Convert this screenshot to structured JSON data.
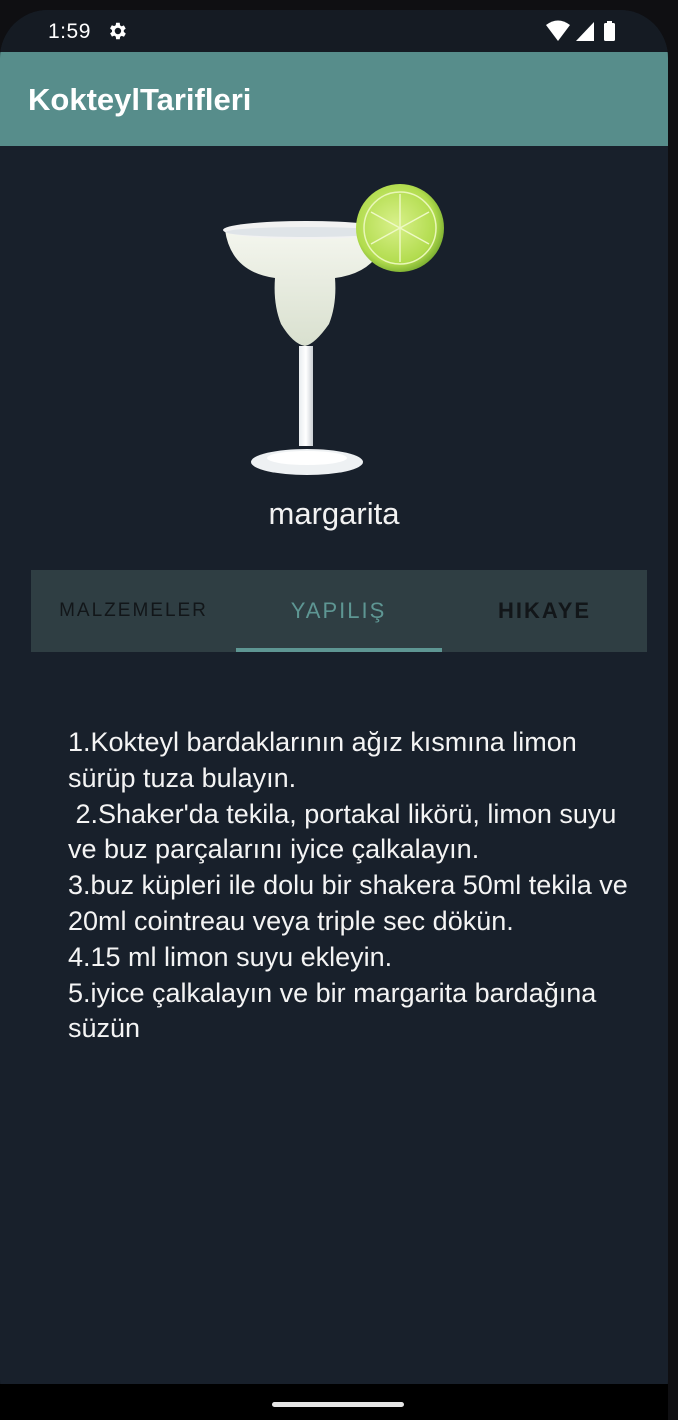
{
  "status_bar": {
    "time": "1:59",
    "icons": [
      "settings-gear-icon",
      "wifi-icon",
      "cellular-signal-icon",
      "battery-icon"
    ]
  },
  "app_bar": {
    "title": "KokteylTarifleri",
    "color": "#578d8b"
  },
  "drink": {
    "image": "margarita-glass-with-lime",
    "name": "margarita"
  },
  "tabs": [
    {
      "label": "MALZEMELER",
      "selected": false
    },
    {
      "label": "YAPILIŞ",
      "selected": true
    },
    {
      "label": "HIKAYE",
      "selected": false
    }
  ],
  "recipe": {
    "lines": [
      "1.Kokteyl bardaklarının ağız kısmına limon sürüp tuza bulayın.",
      " 2.Shaker'da tekila, portakal likörü, limon suyu ve buz parçalarını iyice çalkalayın.",
      "3.buz küpleri ile dolu bir shakera 50ml tekila ve 20ml cointreau veya triple sec dökün.",
      "4.15 ml limon suyu ekleyin.",
      "5.iyice çalkalayın ve bir margarita bardağına süzün"
    ]
  },
  "colors": {
    "background": "#18202b",
    "tab_bar": "#2f3e43",
    "accent": "#5e9693"
  }
}
